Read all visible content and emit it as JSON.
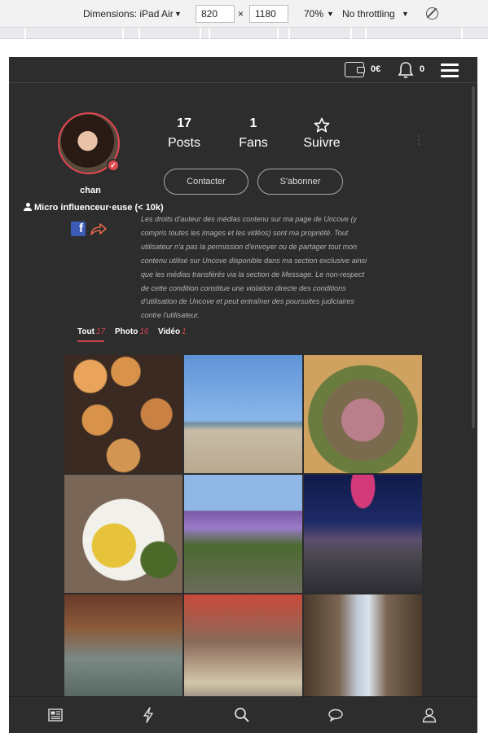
{
  "devtools": {
    "dimensions_label": "Dimensions: iPad Air",
    "width": "820",
    "times": "×",
    "height": "1180",
    "zoom": "70%",
    "throttle": "No throttling"
  },
  "topbar": {
    "wallet_amount": "0€",
    "notifications_count": "0"
  },
  "profile": {
    "username": "chan",
    "level": "Micro influenceur·euse (< 10k)",
    "stats": [
      {
        "value": "17",
        "label": "Posts"
      },
      {
        "value": "1",
        "label": "Fans"
      },
      {
        "value": "",
        "label": "Suivre"
      }
    ],
    "buttons": {
      "contact": "Contacter",
      "subscribe": "S'abonner"
    },
    "disclaimer": "Les droits d'auteur des médias contenu sur ma page de Uncove (y compris toutes les images et les vidéos) sont ma propriété. Tout utilisateur n'a pas la permission d'envoyer ou de partager tout mon contenu utilisé sur Uncove disponible dans ma section exclusive ainsi que les médias transférés via la section de Message. Le non-respect de cette condition constitue une violation directe des conditions d'utilisation de Uncove et peut entraîner des poursuites judiciaires contre l'utilisateur."
  },
  "tabs": [
    {
      "label": "Tout",
      "count": "17"
    },
    {
      "label": "Photo",
      "count": "16"
    },
    {
      "label": "Vidéo",
      "count": "1"
    }
  ],
  "icons": {
    "wallet": "wallet-icon",
    "bell": "bell-icon",
    "menu": "menu-icon",
    "star": "star-icon",
    "facebook": "facebook-icon",
    "share": "share-icon",
    "nav": [
      "news-icon",
      "flash-icon",
      "search-icon",
      "chat-icon",
      "user-icon"
    ]
  },
  "colors": {
    "background": "#2d2d2d",
    "accent": "#d3414c",
    "facebook": "#3b5bb5"
  }
}
